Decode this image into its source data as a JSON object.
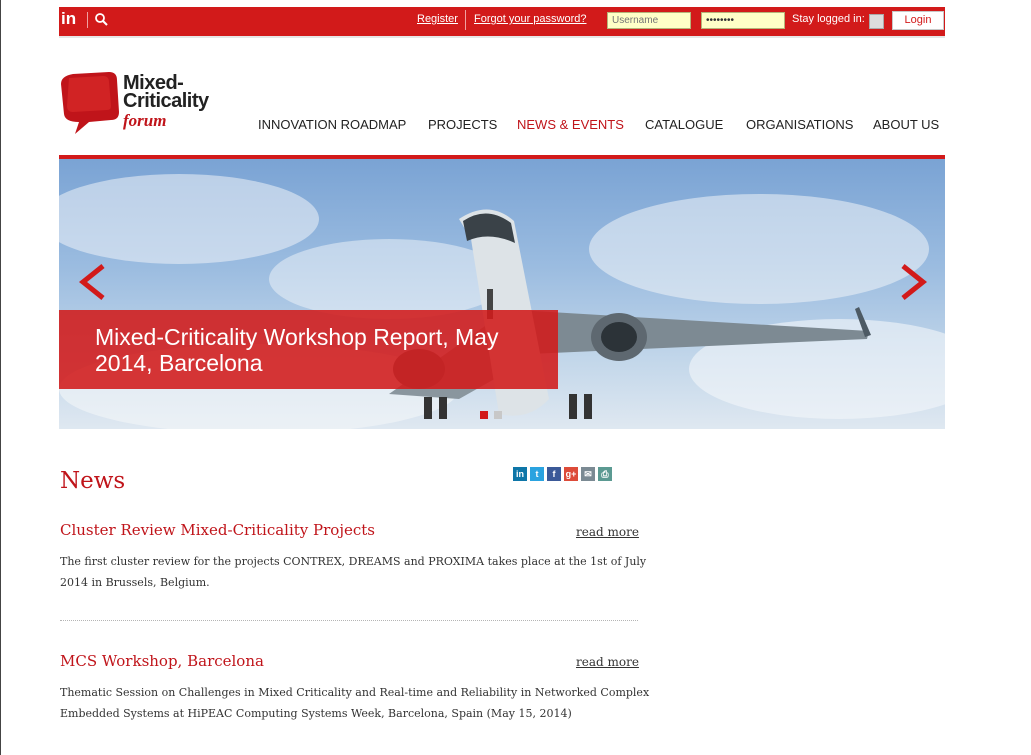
{
  "topbar": {
    "linkedin": "in",
    "register": "Register",
    "forgot": "Forgot your password?",
    "username_placeholder": "Username",
    "password_value": "••••••••",
    "stay_logged_in": "Stay logged in:",
    "login_label": "Login"
  },
  "logo": {
    "line1": "Mixed-",
    "line2": "Criticality",
    "line3": "forum"
  },
  "nav": [
    {
      "label": "INNOVATION ROADMAP",
      "active": false
    },
    {
      "label": "PROJECTS",
      "active": false
    },
    {
      "label": "NEWS & EVENTS",
      "active": true
    },
    {
      "label": "CATALOGUE",
      "active": false
    },
    {
      "label": "ORGANISATIONS",
      "active": false
    },
    {
      "label": "ABOUT US",
      "active": false
    }
  ],
  "slider": {
    "caption": "Mixed-Criticality Workshop Report, May 2014, Barcelona",
    "slide_count": 2,
    "active_slide": 1
  },
  "news": {
    "heading": "News",
    "share_icons": [
      "linkedin-icon",
      "twitter-icon",
      "facebook-icon",
      "googleplus-icon",
      "email-icon",
      "print-icon"
    ],
    "items": [
      {
        "title": "Cluster Review Mixed-Criticality Projects",
        "read_more": "read more",
        "body": "The first cluster review for the projects CONTREX, DREAMS and PROXIMA takes place at the 1st of July 2014 in Brussels, Belgium."
      },
      {
        "title": "MCS Workshop, Barcelona",
        "read_more": "read more",
        "body": "Thematic Session on Challenges in Mixed Criticality and Real-time and Reliability in Networked Complex Embedded Systems at HiPEAC Computing Systems Week, Barcelona, Spain (May 15, 2014)"
      }
    ]
  },
  "colors": {
    "brand_red": "#d21a1a",
    "title_red": "#c0141a",
    "input_yellow": "#ffffc7"
  }
}
